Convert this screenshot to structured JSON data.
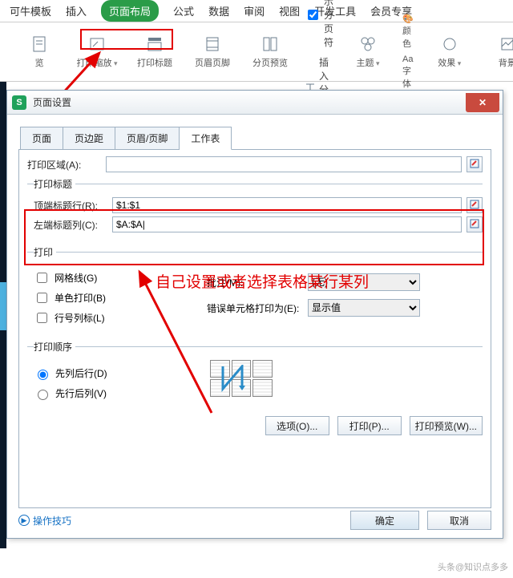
{
  "menu": {
    "template": "可牛模板",
    "insert": "插入",
    "pagelayout": "页面布局",
    "formula": "公式",
    "data": "数据",
    "review": "审阅",
    "view": "视图",
    "dev": "开发工具",
    "member": "会员专享"
  },
  "ribbon": {
    "preview": "览",
    "print_scale": "打印缩放",
    "print_titles": "打印标题",
    "header_footer": "页眉页脚",
    "page_break_preview": "分页预览",
    "show_breaks": "显示分页符",
    "insert_break": "插入分页符",
    "theme": "主题",
    "color": "颜色",
    "font": "字体",
    "effects": "效果",
    "background": "背景"
  },
  "dialog": {
    "title": "页面设置",
    "tabs": {
      "page": "页面",
      "margins": "页边距",
      "headerfooter": "页眉/页脚",
      "sheet": "工作表"
    },
    "sheet": {
      "print_area_label": "打印区域(A):",
      "print_area_value": "",
      "titles_legend": "打印标题",
      "row_label": "顶端标题行(R):",
      "row_value": "$1:$1",
      "col_label": "左端标题列(C):",
      "col_value": "$A:$A|",
      "print_legend": "打印",
      "gridlines": "网格线(G)",
      "bw": "单色打印(B)",
      "rowcol": "行号列标(L)",
      "comments_label": "批注(M):",
      "comments_value": "(无)",
      "errors_label": "错误单元格打印为(E):",
      "errors_value": "显示值",
      "order_legend": "打印顺序",
      "down_over": "先列后行(D)",
      "over_down": "先行后列(V)",
      "options_btn": "选项(O)...",
      "print_btn": "打印(P)...",
      "preview_btn": "打印预览(W)..."
    },
    "footer": {
      "tips": "操作技巧",
      "ok": "确定",
      "cancel": "取消"
    }
  },
  "annotation": "自己设置或者选择表格某行某列",
  "watermark": "头条@知识点多多"
}
